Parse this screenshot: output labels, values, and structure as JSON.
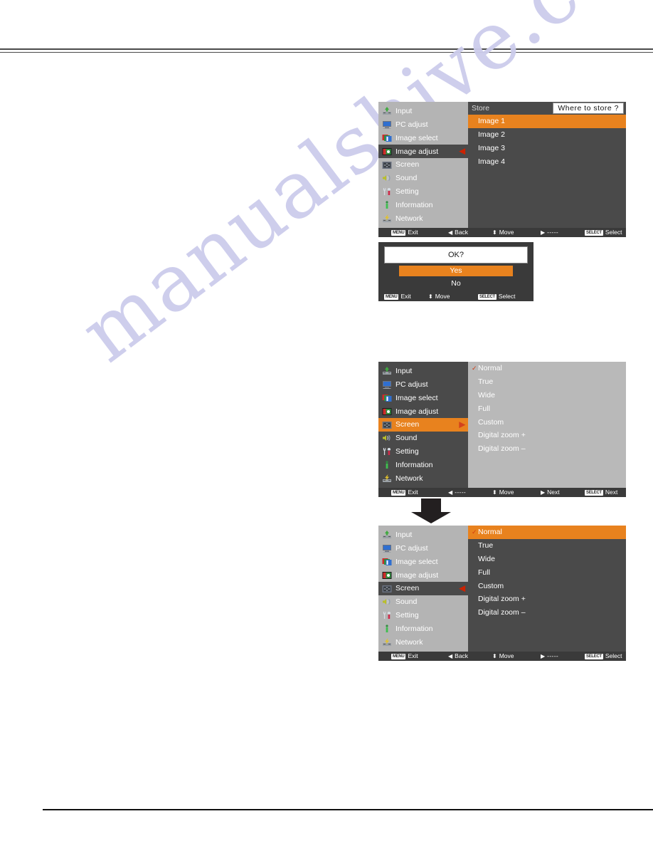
{
  "page": {
    "watermark": "manualshive.com"
  },
  "menu": {
    "items": [
      {
        "label": "Input",
        "icon": "input-icon"
      },
      {
        "label": "PC adjust",
        "icon": "pc-adjust-icon"
      },
      {
        "label": "Image select",
        "icon": "image-select-icon"
      },
      {
        "label": "Image adjust",
        "icon": "image-adjust-icon"
      },
      {
        "label": "Screen",
        "icon": "screen-icon"
      },
      {
        "label": "Sound",
        "icon": "sound-icon"
      },
      {
        "label": "Setting",
        "icon": "setting-icon"
      },
      {
        "label": "Information",
        "icon": "information-icon"
      },
      {
        "label": "Network",
        "icon": "network-icon"
      }
    ]
  },
  "panel_store": {
    "header_left": "Store",
    "header_right": "Where to store ?",
    "selected_menu": "Image adjust",
    "caret": "◀",
    "items": [
      {
        "label": "Image 1",
        "selected": true
      },
      {
        "label": "Image 2",
        "selected": false
      },
      {
        "label": "Image 3",
        "selected": false
      },
      {
        "label": "Image 4",
        "selected": false
      }
    ],
    "guide": {
      "exit_key": "MENU",
      "exit_label": "Exit",
      "back_arrow": "◀",
      "back_label": "Back",
      "move_arrow": "⬍",
      "move_label": "Move",
      "next_arrow": "▶",
      "next_label": "- - - - -",
      "select_key": "SELECT",
      "select_label": "Select"
    }
  },
  "dialog_ok": {
    "title": "OK?",
    "yes": "Yes",
    "no": "No",
    "guide": {
      "exit_key": "MENU",
      "exit_label": "Exit",
      "move_arrow": "⬍",
      "move_label": "Move",
      "select_key": "SELECT",
      "select_label": "Select"
    }
  },
  "panel_screen_top": {
    "selected_menu": "Screen",
    "caret": "▶",
    "items": [
      {
        "label": "Normal",
        "checked": true
      },
      {
        "label": "True",
        "checked": false
      },
      {
        "label": "Wide",
        "checked": false
      },
      {
        "label": "Full",
        "checked": false
      },
      {
        "label": "Custom",
        "checked": false
      },
      {
        "label": "Digital zoom +",
        "checked": false
      },
      {
        "label": "Digital zoom –",
        "checked": false
      }
    ],
    "guide": {
      "exit_key": "MENU",
      "exit_label": "Exit",
      "back_arrow": "◀",
      "back_label": "- - - - -",
      "move_arrow": "⬍",
      "move_label": "Move",
      "next_arrow": "▶",
      "next_label": "Next",
      "select_key": "SELECT",
      "select_label": "Next"
    }
  },
  "panel_screen_bottom": {
    "selected_menu": "Screen",
    "caret": "◀",
    "highlighted_item": "Normal",
    "items": [
      {
        "label": "Normal",
        "checked": true
      },
      {
        "label": "True",
        "checked": false
      },
      {
        "label": "Wide",
        "checked": false
      },
      {
        "label": "Full",
        "checked": false
      },
      {
        "label": "Custom",
        "checked": false
      },
      {
        "label": "Digital zoom +",
        "checked": false
      },
      {
        "label": "Digital zoom –",
        "checked": false
      }
    ],
    "guide": {
      "exit_key": "MENU",
      "exit_label": "Exit",
      "back_arrow": "◀",
      "back_label": "Back",
      "move_arrow": "⬍",
      "move_label": "Move",
      "next_arrow": "▶",
      "next_label": "- - - - -",
      "select_key": "SELECT",
      "select_label": "Select"
    }
  },
  "colors": {
    "accent_orange": "#e8821e",
    "panel_dark": "#4a4a4a",
    "panel_light": "#b9b9b9",
    "guide_bar": "#3a3a3a"
  }
}
